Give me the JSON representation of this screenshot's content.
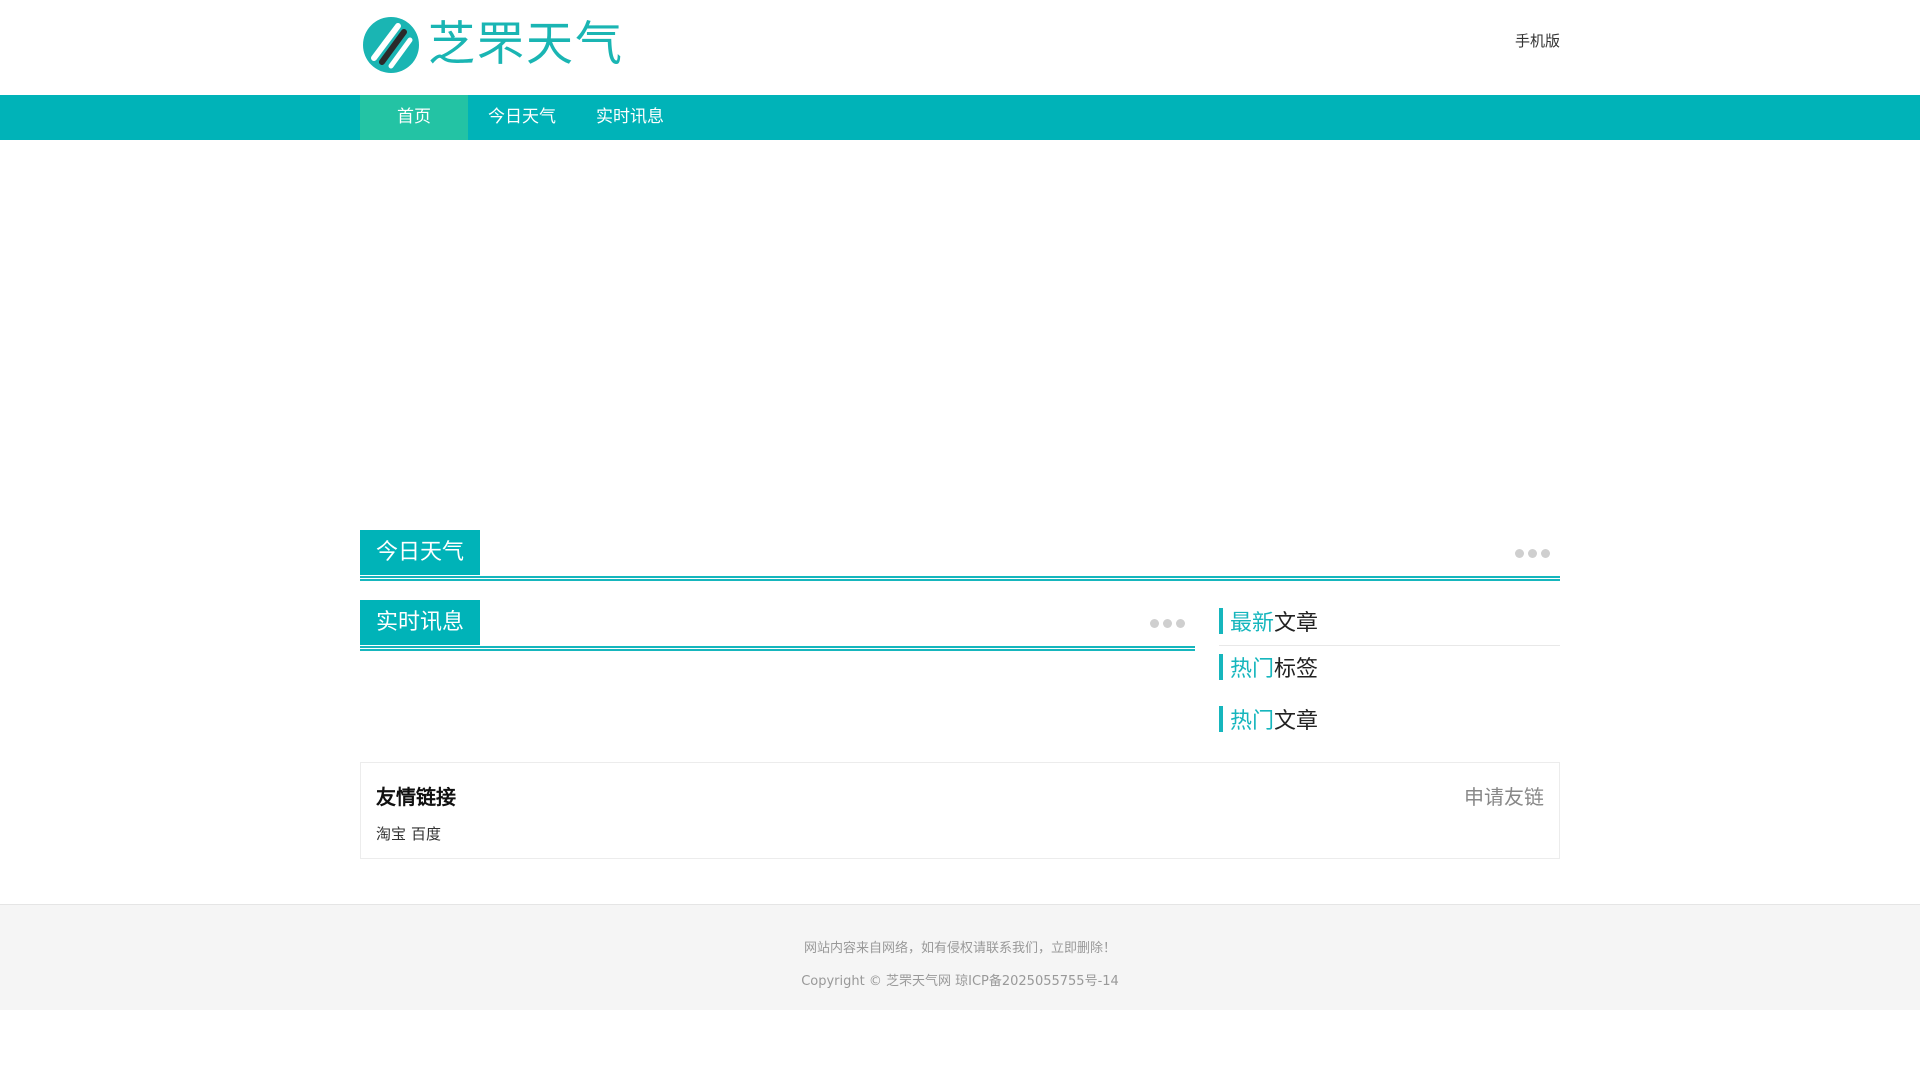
{
  "header": {
    "logo_text": "芝罘天气",
    "mobile_link": "手机版"
  },
  "nav": {
    "items": [
      {
        "label": "首页",
        "active": true
      },
      {
        "label": "今日天气",
        "active": false
      },
      {
        "label": "实时讯息",
        "active": false
      }
    ]
  },
  "sections": {
    "today": {
      "title": "今日天气"
    },
    "news": {
      "title": "实时讯息"
    }
  },
  "sidebar": {
    "latest": {
      "hl": "最新",
      "rest": "文章"
    },
    "hot_tags": {
      "hl": "热门",
      "rest": "标签"
    },
    "hot_articles": {
      "hl": "热门",
      "rest": "文章"
    }
  },
  "friend_links": {
    "title": "友情链接",
    "apply": "申请友链",
    "items": [
      "淘宝",
      "百度"
    ]
  },
  "footer": {
    "line1": "网站内容来自网络，如有侵权请联系我们，立即删除！",
    "line2": "Copyright © 芝罘天气网 琼ICP备2025055755号-14"
  },
  "colors": {
    "brand": "#00b3b8",
    "active_nav": "#23c3a4",
    "accent_text": "#16b6bd"
  }
}
